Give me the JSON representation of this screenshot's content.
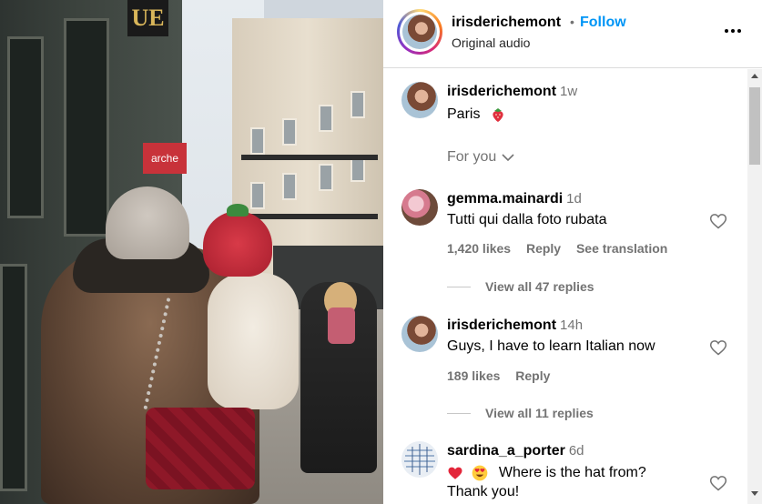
{
  "header": {
    "username": "irisderichemont",
    "separator": "•",
    "follow_label": "Follow",
    "audio_label": "Original audio",
    "more_icon": "more-horizontal-icon"
  },
  "caption": {
    "username": "irisderichemont",
    "time": "1w",
    "text": "Paris"
  },
  "sort": {
    "label": "For you"
  },
  "comments": [
    {
      "username": "gemma.mainardi",
      "time": "1d",
      "text": "Tutti qui dalla foto rubata",
      "likes": "1,420 likes",
      "reply": "Reply",
      "translate": "See translation",
      "view_replies": "View all 47 replies"
    },
    {
      "username": "irisderichemont",
      "time": "14h",
      "text": "Guys, I have to learn Italian now",
      "likes": "189 likes",
      "reply": "Reply",
      "view_replies": "View all 11 replies"
    },
    {
      "username": "sardina_a_porter",
      "time": "6d",
      "text": "Where is the hat from?",
      "text_line2": "Thank you!"
    }
  ],
  "media": {
    "sign_text": "UE",
    "shop_sign": "arche"
  },
  "colors": {
    "accent": "#0095f6",
    "secondary_text": "#737373"
  }
}
